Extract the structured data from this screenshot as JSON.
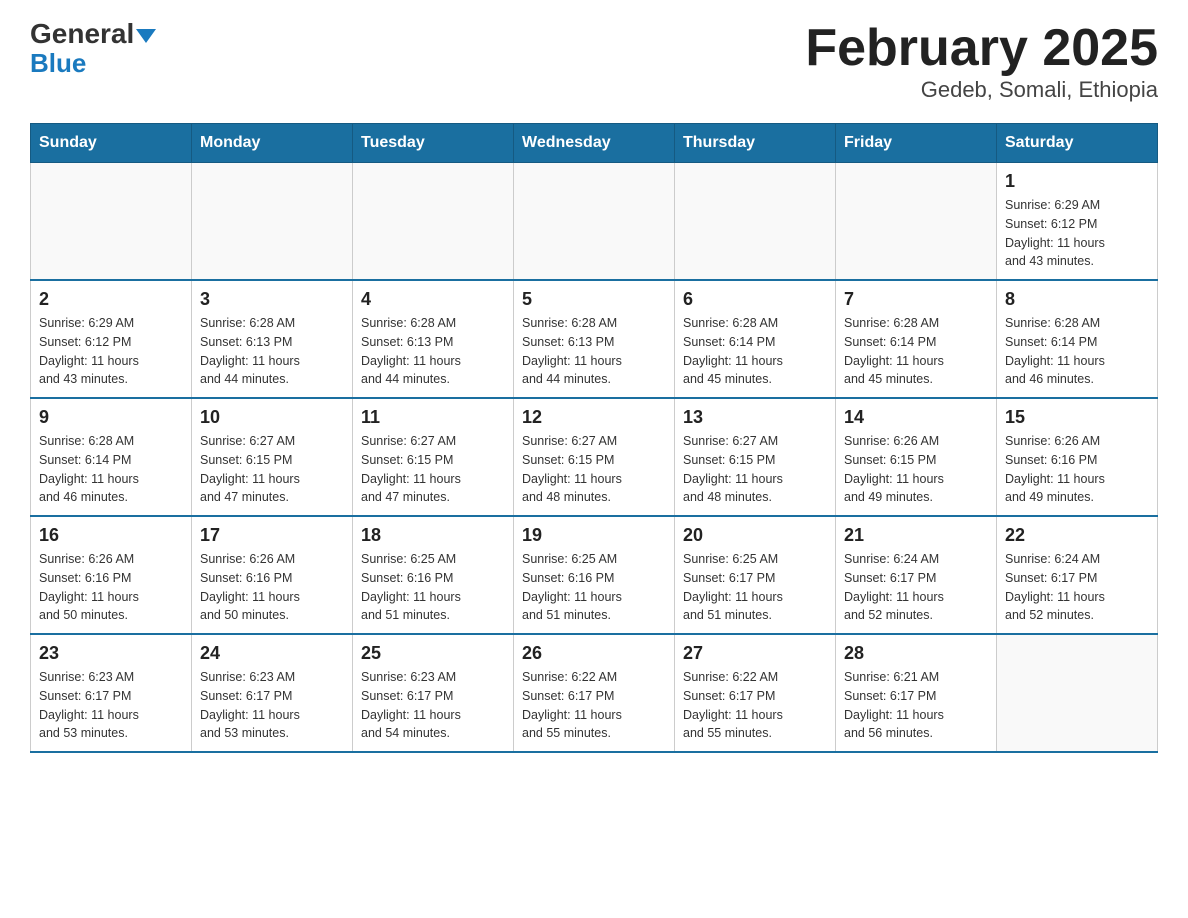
{
  "header": {
    "logo_general": "General",
    "logo_blue": "Blue",
    "title": "February 2025",
    "subtitle": "Gedeb, Somali, Ethiopia"
  },
  "days_of_week": [
    "Sunday",
    "Monday",
    "Tuesday",
    "Wednesday",
    "Thursday",
    "Friday",
    "Saturday"
  ],
  "weeks": [
    [
      {
        "day": "",
        "info": ""
      },
      {
        "day": "",
        "info": ""
      },
      {
        "day": "",
        "info": ""
      },
      {
        "day": "",
        "info": ""
      },
      {
        "day": "",
        "info": ""
      },
      {
        "day": "",
        "info": ""
      },
      {
        "day": "1",
        "info": "Sunrise: 6:29 AM\nSunset: 6:12 PM\nDaylight: 11 hours\nand 43 minutes."
      }
    ],
    [
      {
        "day": "2",
        "info": "Sunrise: 6:29 AM\nSunset: 6:12 PM\nDaylight: 11 hours\nand 43 minutes."
      },
      {
        "day": "3",
        "info": "Sunrise: 6:28 AM\nSunset: 6:13 PM\nDaylight: 11 hours\nand 44 minutes."
      },
      {
        "day": "4",
        "info": "Sunrise: 6:28 AM\nSunset: 6:13 PM\nDaylight: 11 hours\nand 44 minutes."
      },
      {
        "day": "5",
        "info": "Sunrise: 6:28 AM\nSunset: 6:13 PM\nDaylight: 11 hours\nand 44 minutes."
      },
      {
        "day": "6",
        "info": "Sunrise: 6:28 AM\nSunset: 6:14 PM\nDaylight: 11 hours\nand 45 minutes."
      },
      {
        "day": "7",
        "info": "Sunrise: 6:28 AM\nSunset: 6:14 PM\nDaylight: 11 hours\nand 45 minutes."
      },
      {
        "day": "8",
        "info": "Sunrise: 6:28 AM\nSunset: 6:14 PM\nDaylight: 11 hours\nand 46 minutes."
      }
    ],
    [
      {
        "day": "9",
        "info": "Sunrise: 6:28 AM\nSunset: 6:14 PM\nDaylight: 11 hours\nand 46 minutes."
      },
      {
        "day": "10",
        "info": "Sunrise: 6:27 AM\nSunset: 6:15 PM\nDaylight: 11 hours\nand 47 minutes."
      },
      {
        "day": "11",
        "info": "Sunrise: 6:27 AM\nSunset: 6:15 PM\nDaylight: 11 hours\nand 47 minutes."
      },
      {
        "day": "12",
        "info": "Sunrise: 6:27 AM\nSunset: 6:15 PM\nDaylight: 11 hours\nand 48 minutes."
      },
      {
        "day": "13",
        "info": "Sunrise: 6:27 AM\nSunset: 6:15 PM\nDaylight: 11 hours\nand 48 minutes."
      },
      {
        "day": "14",
        "info": "Sunrise: 6:26 AM\nSunset: 6:15 PM\nDaylight: 11 hours\nand 49 minutes."
      },
      {
        "day": "15",
        "info": "Sunrise: 6:26 AM\nSunset: 6:16 PM\nDaylight: 11 hours\nand 49 minutes."
      }
    ],
    [
      {
        "day": "16",
        "info": "Sunrise: 6:26 AM\nSunset: 6:16 PM\nDaylight: 11 hours\nand 50 minutes."
      },
      {
        "day": "17",
        "info": "Sunrise: 6:26 AM\nSunset: 6:16 PM\nDaylight: 11 hours\nand 50 minutes."
      },
      {
        "day": "18",
        "info": "Sunrise: 6:25 AM\nSunset: 6:16 PM\nDaylight: 11 hours\nand 51 minutes."
      },
      {
        "day": "19",
        "info": "Sunrise: 6:25 AM\nSunset: 6:16 PM\nDaylight: 11 hours\nand 51 minutes."
      },
      {
        "day": "20",
        "info": "Sunrise: 6:25 AM\nSunset: 6:17 PM\nDaylight: 11 hours\nand 51 minutes."
      },
      {
        "day": "21",
        "info": "Sunrise: 6:24 AM\nSunset: 6:17 PM\nDaylight: 11 hours\nand 52 minutes."
      },
      {
        "day": "22",
        "info": "Sunrise: 6:24 AM\nSunset: 6:17 PM\nDaylight: 11 hours\nand 52 minutes."
      }
    ],
    [
      {
        "day": "23",
        "info": "Sunrise: 6:23 AM\nSunset: 6:17 PM\nDaylight: 11 hours\nand 53 minutes."
      },
      {
        "day": "24",
        "info": "Sunrise: 6:23 AM\nSunset: 6:17 PM\nDaylight: 11 hours\nand 53 minutes."
      },
      {
        "day": "25",
        "info": "Sunrise: 6:23 AM\nSunset: 6:17 PM\nDaylight: 11 hours\nand 54 minutes."
      },
      {
        "day": "26",
        "info": "Sunrise: 6:22 AM\nSunset: 6:17 PM\nDaylight: 11 hours\nand 55 minutes."
      },
      {
        "day": "27",
        "info": "Sunrise: 6:22 AM\nSunset: 6:17 PM\nDaylight: 11 hours\nand 55 minutes."
      },
      {
        "day": "28",
        "info": "Sunrise: 6:21 AM\nSunset: 6:17 PM\nDaylight: 11 hours\nand 56 minutes."
      },
      {
        "day": "",
        "info": ""
      }
    ]
  ]
}
